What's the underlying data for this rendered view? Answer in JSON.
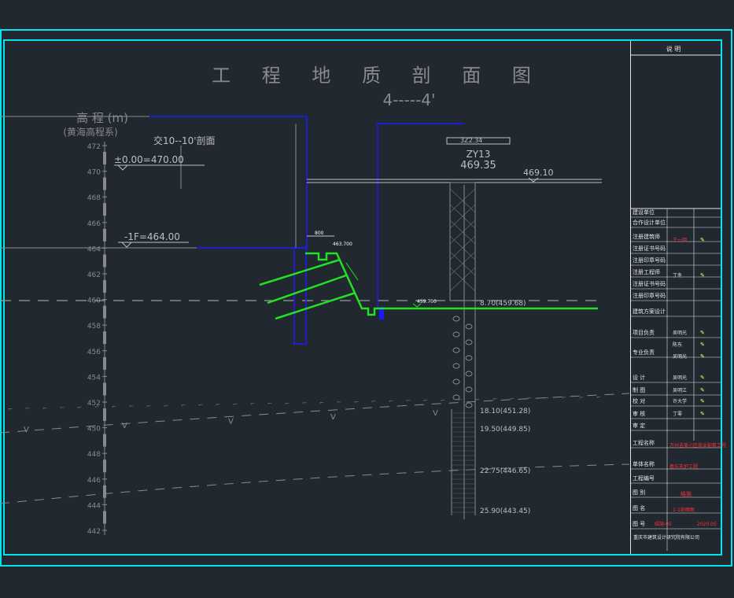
{
  "drawing": {
    "title": "工 程 地 质 剖 面 图",
    "subtitle": "4-----4'",
    "axis_label": "高 程 (m)",
    "axis_sublabel": "(黄海高程系)",
    "cross_ref": "交10--10'剖面",
    "zero_elev": "±0.00=470.00",
    "floor_elev": "-1F=464.00",
    "borehole_id": "ZY13",
    "borehole_elev": "469.35",
    "borehole_top": "3Z2.34",
    "ground_elev": "469.10",
    "level_label_1": "463.700",
    "level_label_2": "459.700",
    "dim_label": "800",
    "layer_labels": [
      "8.70(459.68)",
      "18.10(451.28)",
      "19.50(449.85)",
      "22.75(446.65)",
      "25.90(443.45)"
    ],
    "elev_ticks": [
      "472",
      "470",
      "468",
      "466",
      "464",
      "462",
      "460",
      "458",
      "456",
      "454",
      "452",
      "450",
      "448",
      "446",
      "444",
      "442"
    ]
  },
  "title_block": {
    "header": "说 明",
    "rows": [
      "建设单位",
      "合作设计单位",
      "注册建筑师",
      "注册证书号码",
      "注册印章号码",
      "注册工程师",
      "注册证书号码",
      "注册印章号码",
      "建筑方案设计",
      "项目负责",
      "专业负责",
      "设 计",
      "制 图",
      "校 对",
      "审 核",
      "审 定",
      "工程名称",
      "单体名称",
      "工程编号",
      "图 别",
      "图 名",
      "图 号"
    ],
    "values": [
      "王一明",
      "丁冬",
      "吴明光",
      "陈东",
      "吴明光",
      "吴明光",
      "吴明江",
      "许大学",
      "丁零"
    ],
    "project": "万州吉美小区商业配套工程",
    "building": "基坑支护工程",
    "drawing_category": "结施",
    "drawing_name": "1-1剖面图",
    "drawing_number": "结施-05",
    "date": "2020.05",
    "company": "重庆市建筑设计研究院有限公司"
  }
}
